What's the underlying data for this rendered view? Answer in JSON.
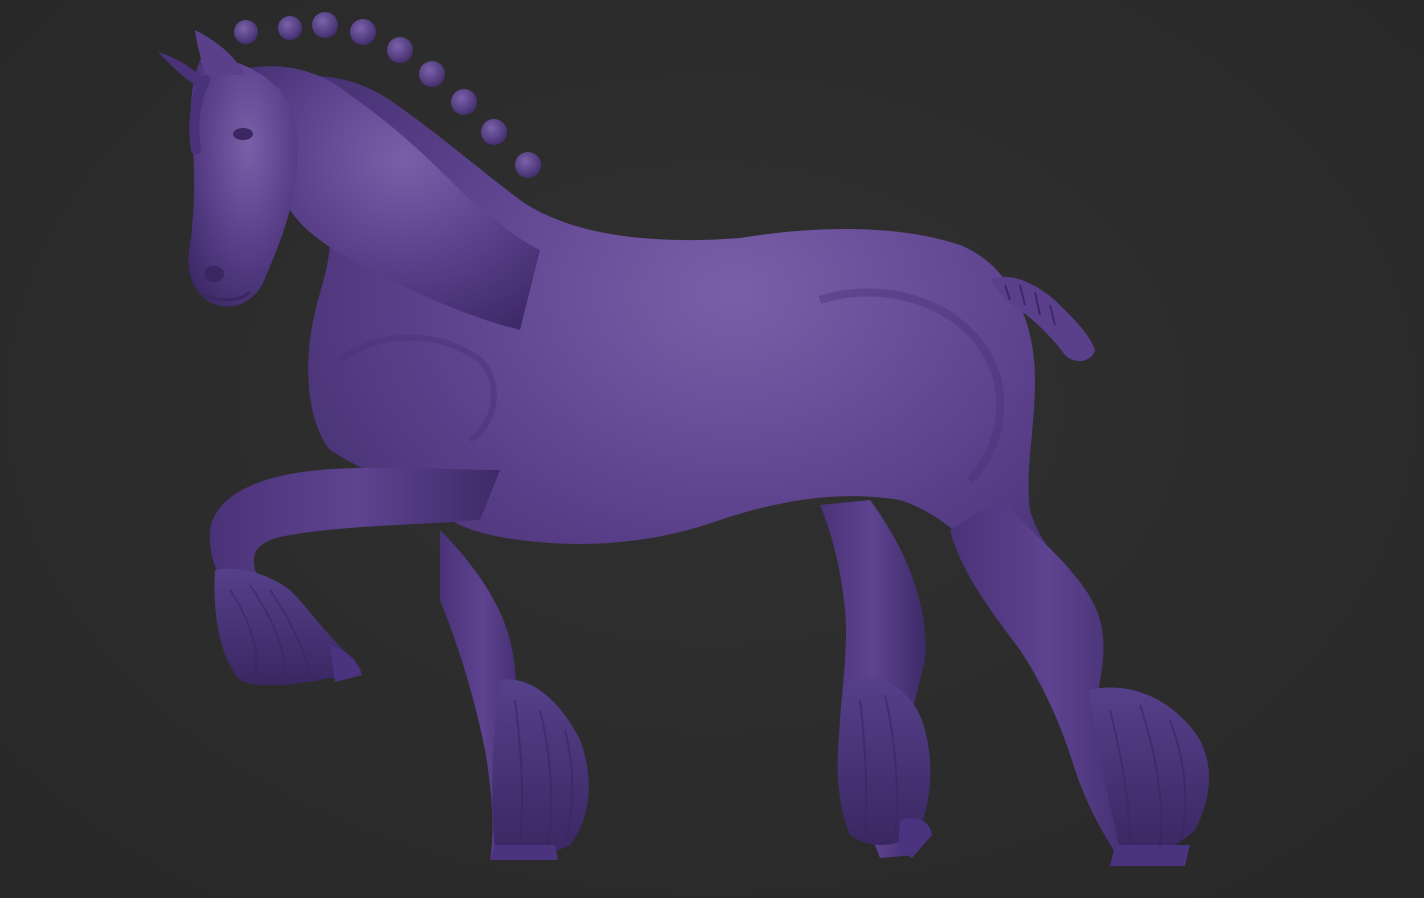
{
  "scene": {
    "background_color": "#2b2b2b",
    "model_material_color": "#5b3f88",
    "model_highlight_color": "#7a5fa8",
    "model_shadow_color": "#3a2660",
    "subject": "horse-sculpt"
  }
}
